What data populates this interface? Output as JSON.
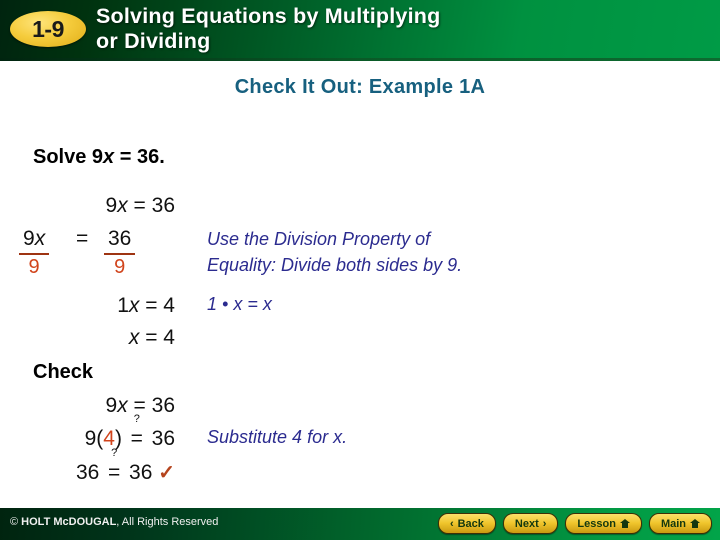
{
  "header": {
    "badge": "1-9",
    "title_line1": "Solving Equations by Multiplying",
    "title_line2": "or Dividing"
  },
  "slide": {
    "example_heading": "Check It Out: Example 1A",
    "solve_prompt_prefix": "Solve 9",
    "solve_prompt_var": "x",
    "solve_prompt_suffix": " = 36."
  },
  "work": {
    "line1_left": "9",
    "line1_var": "x",
    "line1_right": " = 36",
    "fraction": {
      "numerator_left": "9x",
      "numerator_left_coef": "9",
      "numerator_left_var": "x",
      "denominator_left": "9",
      "equals": "=",
      "numerator_right": "36",
      "denominator_right": "9"
    },
    "note_division_line1": "Use the Division Property of",
    "note_division_line2": "Equality: Divide both sides by 9.",
    "line3_coef": "1",
    "line3_var": "x",
    "line3_right": " = 4",
    "note_identity_one": "1",
    "note_identity_dot": "•",
    "note_identity_x1": "x",
    "note_identity_eq": "=",
    "note_identity_x2": "x",
    "line4_var": "x",
    "line4_right": " = 4"
  },
  "check": {
    "label": "Check",
    "row1_coef": "9",
    "row1_var": "x",
    "row1_right": " = 36",
    "row2_prefix": "9(",
    "row2_value": "4",
    "row2_suffix": ")",
    "row2_question": "?",
    "row2_equals": "=",
    "row2_right": "36",
    "row3_left": "36",
    "row3_question": "?",
    "row3_equals": "=",
    "row3_right": "36",
    "row3_checkmark": "✓",
    "note_substitute_prefix": "Substitute 4 for ",
    "note_substitute_var": "x",
    "note_substitute_suffix": "."
  },
  "footer": {
    "copyright_symbol": "© ",
    "copyright_brand": "HOLT McDOUGAL",
    "copyright_rest": ", All Rights Reserved",
    "buttons": [
      {
        "label": "Back",
        "chevron": "‹",
        "chevron_side": "left",
        "icon": "none"
      },
      {
        "label": "Next",
        "chevron": "›",
        "chevron_side": "right",
        "icon": "none"
      },
      {
        "label": "Lesson",
        "chevron": "",
        "chevron_side": "none",
        "icon": "home"
      },
      {
        "label": "Main",
        "chevron": "",
        "chevron_side": "none",
        "icon": "home"
      }
    ]
  },
  "colors": {
    "header_green_dark": "#00240f",
    "header_green_bright": "#009b46",
    "badge_gold": "#f5cc3c",
    "example_heading_blue": "#17607f",
    "annotation_navy": "#2b2b8f",
    "highlight_red": "#d1441c",
    "fraction_bar_red": "#9e3412"
  }
}
